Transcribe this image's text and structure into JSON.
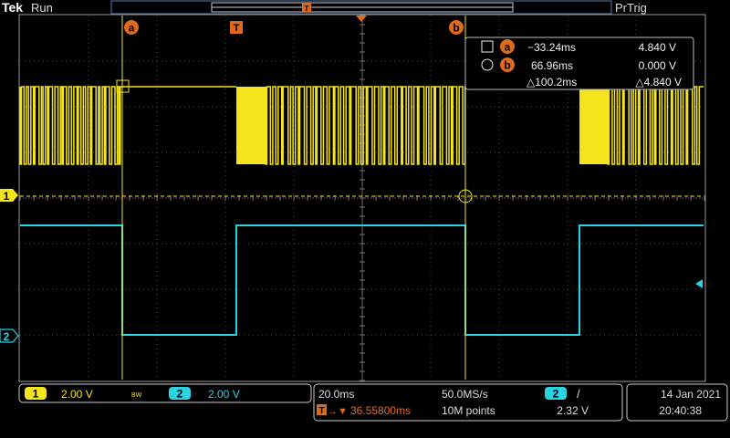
{
  "header": {
    "brand": "Tek",
    "run_state": "Run",
    "trigger_mode": "PrTrig"
  },
  "markers": {
    "cursor_a": "a",
    "cursor_b": "b",
    "trigger": "T"
  },
  "cursor_readout": {
    "a_time": "−33.24ms",
    "a_value": "4.840 V",
    "b_time": "66.96ms",
    "b_value": "0.000 V",
    "delta_time": "△100.2ms",
    "delta_value": "△4.840 V"
  },
  "channels": {
    "ch1": {
      "number": "1",
      "scale": "2.00 V",
      "bw": "BW",
      "color": "#f4e41c"
    },
    "ch2": {
      "number": "2",
      "scale": "2.00 V",
      "color": "#29d3e3"
    }
  },
  "timebase": {
    "scale": "20.0ms",
    "sample_rate": "50.0MS/s",
    "record_length": "10M points",
    "trigger_position": "36.55800ms"
  },
  "trigger": {
    "source": "2",
    "slope": "/",
    "level": "2.32 V"
  },
  "clock": {
    "date": "14 Jan  2021",
    "time": "20:40:38"
  },
  "colors": {
    "accent_orange": "#e06a1c",
    "grid": "#4a4a4a",
    "frame": "#9a9a9a"
  }
}
